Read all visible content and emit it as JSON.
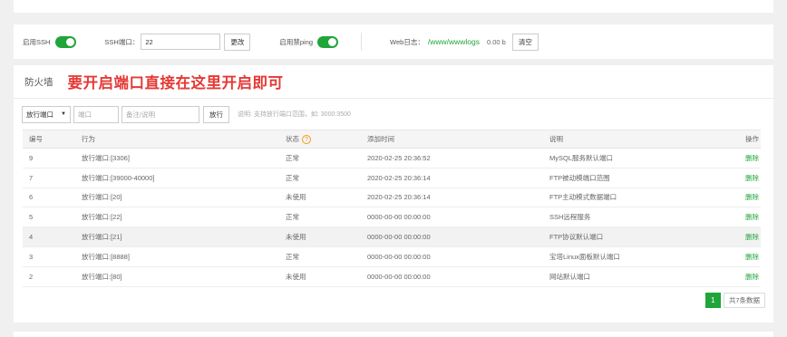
{
  "ssh": {
    "enable_label": "启用SSH",
    "port_label": "SSH端口：",
    "port_value": "22",
    "change_button": "更改",
    "ping_label": "启用禁ping",
    "web_log_label": "Web日志：",
    "web_log_path": "/www/wwwlogs",
    "web_log_size": "0.00 b",
    "clear_button": "清空"
  },
  "firewall": {
    "title": "防火墙",
    "note": "要开启端口直接在这里开启即可",
    "toolbar": {
      "select_value": "放行端口",
      "port_placeholder": "端口",
      "remark_placeholder": "备注/说明",
      "allow_button": "放行",
      "hint": "说明: 支持放行端口范围，如: 3000:3500"
    },
    "columns": [
      "编号",
      "行为",
      "状态",
      "添加时间",
      "说明",
      "操作"
    ],
    "rows": [
      {
        "id": "9",
        "action": "放行端口:[3306]",
        "status": "正常",
        "time": "2020-02-25 20:36:52",
        "desc": "MySQL服务默认端口",
        "op": "删除"
      },
      {
        "id": "7",
        "action": "放行端口:[39000-40000]",
        "status": "正常",
        "time": "2020-02-25 20:36:14",
        "desc": "FTP被动模端口范围",
        "op": "删除"
      },
      {
        "id": "6",
        "action": "放行端口:[20]",
        "status": "未使用",
        "time": "2020-02-25 20:36:14",
        "desc": "FTP主动模式数据端口",
        "op": "删除"
      },
      {
        "id": "5",
        "action": "放行端口:[22]",
        "status": "正常",
        "time": "0000-00-00 00:00:00",
        "desc": "SSH远程服务",
        "op": "删除"
      },
      {
        "id": "4",
        "action": "放行端口:[21]",
        "status": "未使用",
        "time": "0000-00-00 00:00:00",
        "desc": "FTP协议默认端口",
        "op": "删除"
      },
      {
        "id": "3",
        "action": "放行端口:[8888]",
        "status": "正常",
        "time": "0000-00-00 00:00:00",
        "desc": "宝塔Linux面板默认端口",
        "op": "删除"
      },
      {
        "id": "2",
        "action": "放行端口:[80]",
        "status": "未使用",
        "time": "0000-00-00 00:00:00",
        "desc": "网站默认端口",
        "op": "删除"
      }
    ],
    "pager": {
      "current": "1",
      "total": "共7条数据"
    }
  },
  "colors": {
    "accent": "#20a53a",
    "note": "#e53935",
    "help": "#f39c12"
  }
}
